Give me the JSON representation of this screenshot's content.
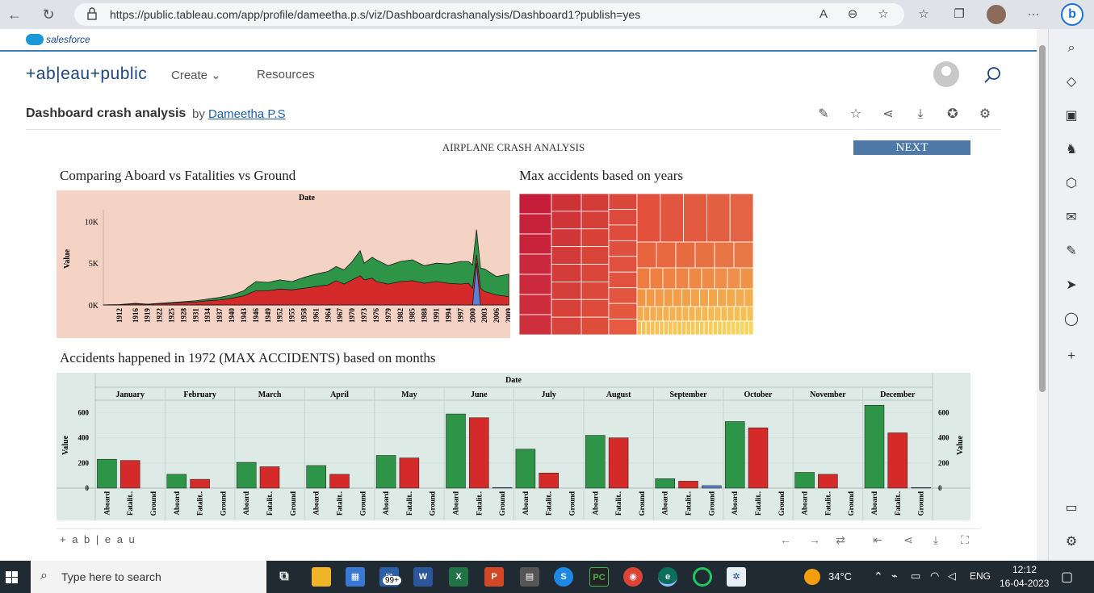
{
  "browser": {
    "url": "https://public.tableau.com/app/profile/dameetha.p.s/viz/Dashboardcrashanalysis/Dashboard1?publish=yes"
  },
  "salesforce": {
    "label": "salesforce"
  },
  "tableau_header": {
    "logo": "+ab|eau+public",
    "nav": [
      "Create ⌄",
      "Resources"
    ]
  },
  "viz": {
    "title": "Dashboard crash analysis",
    "by": "by",
    "author": "Dameetha P.S"
  },
  "dashboard": {
    "title": "AIRPLANE CRASH ANALYSIS",
    "next_label": "NEXT",
    "sheet1_title": "Comparing Aboard vs Fatalities vs Ground",
    "sheet2_title": "Max accidents based on years",
    "sheet3_title": "Accidents happened in 1972 (MAX ACCIDENTS) based on months"
  },
  "chart_data": [
    {
      "type": "area",
      "title": "Comparing Aboard vs Fatalities vs Ground",
      "header": "Date",
      "ylabel": "Value",
      "ylim": [
        0,
        11000
      ],
      "y_ticks": [
        "0K",
        "5K",
        "10K"
      ],
      "x_tick_labels": [
        "1912",
        "1916",
        "1919",
        "1922",
        "1925",
        "1928",
        "1931",
        "1934",
        "1937",
        "1940",
        "1943",
        "1946",
        "1949",
        "1952",
        "1955",
        "1958",
        "1961",
        "1964",
        "1967",
        "1970",
        "1973",
        "1976",
        "1979",
        "1982",
        "1985",
        "1988",
        "1991",
        "1994",
        "1997",
        "2000",
        "2003",
        "2006",
        "2009"
      ],
      "colors": {
        "Aboard": "#2e9447",
        "Fatalities": "#d42a2a",
        "Ground": "#5b7fd1"
      },
      "x": [
        1908,
        1912,
        1916,
        1919,
        1922,
        1925,
        1928,
        1931,
        1934,
        1937,
        1940,
        1943,
        1944,
        1946,
        1949,
        1952,
        1955,
        1958,
        1961,
        1964,
        1966,
        1968,
        1970,
        1972,
        1973,
        1975,
        1976,
        1979,
        1982,
        1985,
        1988,
        1991,
        1994,
        1997,
        1999,
        2000,
        2001,
        2002,
        2003,
        2006,
        2009
      ],
      "series": [
        {
          "name": "Aboard",
          "values": [
            10,
            50,
            200,
            100,
            200,
            300,
            400,
            500,
            700,
            900,
            1200,
            1700,
            2100,
            2800,
            2700,
            3000,
            2800,
            3300,
            3700,
            4000,
            4600,
            4200,
            5200,
            6500,
            5000,
            5700,
            5400,
            4700,
            5200,
            5400,
            4700,
            5000,
            4900,
            5200,
            5200,
            4800,
            9000,
            4400,
            4300,
            3400,
            3700
          ]
        },
        {
          "name": "Fatalities",
          "values": [
            5,
            30,
            150,
            80,
            150,
            200,
            300,
            350,
            500,
            600,
            800,
            1100,
            1300,
            1700,
            1700,
            1900,
            1800,
            2000,
            2200,
            2400,
            2900,
            2500,
            3000,
            3500,
            3000,
            3200,
            2800,
            2500,
            2800,
            2900,
            2600,
            2800,
            2600,
            2500,
            2600,
            2000,
            6000,
            2000,
            1600,
            1200,
            1000
          ]
        },
        {
          "name": "Ground",
          "values": [
            0,
            0,
            0,
            0,
            0,
            0,
            0,
            0,
            0,
            0,
            0,
            0,
            0,
            0,
            0,
            0,
            0,
            0,
            0,
            0,
            0,
            0,
            0,
            0,
            0,
            0,
            0,
            0,
            0,
            0,
            0,
            0,
            0,
            0,
            0,
            0,
            5000,
            0,
            0,
            0,
            0
          ]
        }
      ]
    },
    {
      "type": "treemap",
      "title": "Max accidents based on years",
      "values_note": "rectangles sized and colored by accident count per year (labels not shown)"
    },
    {
      "type": "bar",
      "title": "Accidents happened in 1972 (MAX ACCIDENTS) based on months",
      "header": "Date",
      "ylabel": "Value",
      "ylim": [
        0,
        700
      ],
      "y_ticks": [
        0,
        200,
        400,
        600
      ],
      "measures": [
        "Aboard",
        "Fatalit..",
        "Ground"
      ],
      "colors": {
        "Aboard": "#2e9447",
        "Fatalities": "#d42a2a",
        "Ground": "#5b7fd1"
      },
      "categories": [
        "January",
        "February",
        "March",
        "April",
        "May",
        "June",
        "July",
        "August",
        "September",
        "October",
        "November",
        "December"
      ],
      "series": [
        {
          "name": "Aboard",
          "values": [
            230,
            110,
            205,
            180,
            260,
            590,
            310,
            420,
            75,
            530,
            125,
            660
          ]
        },
        {
          "name": "Fatalities",
          "values": [
            220,
            70,
            170,
            110,
            240,
            560,
            120,
            400,
            55,
            480,
            110,
            440
          ]
        },
        {
          "name": "Ground",
          "values": [
            0,
            0,
            0,
            0,
            0,
            5,
            0,
            0,
            20,
            0,
            0,
            5
          ]
        }
      ]
    }
  ],
  "tableau_footer": {
    "logo": "+ a b | e a u"
  },
  "taskbar": {
    "search_placeholder": "Type here to search",
    "weather": "34°C",
    "lang": "ENG",
    "time": "12:12",
    "date": "16-04-2023",
    "notif_badge": "99+"
  }
}
